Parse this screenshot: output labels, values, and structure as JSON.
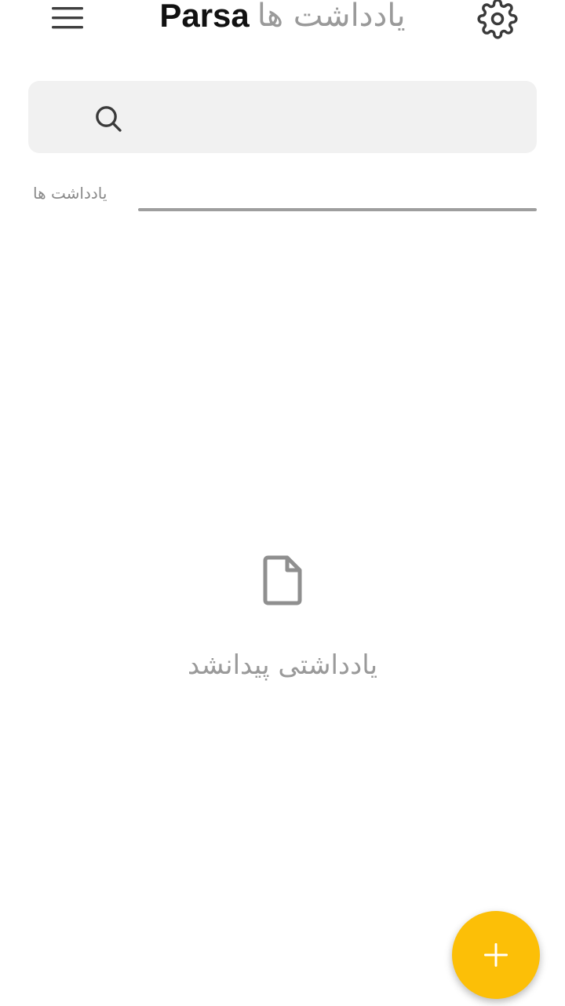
{
  "header": {
    "brand": "Parsa",
    "title": "یادداشت ها",
    "menu_icon": "hamburger-menu-icon",
    "settings_icon": "gear-icon"
  },
  "search": {
    "placeholder": "",
    "value": "",
    "icon": "search-icon"
  },
  "section": {
    "label": "یادداشت ها"
  },
  "empty_state": {
    "icon": "file-icon",
    "message": "یادداشتی پیدانشد"
  },
  "fab": {
    "icon": "plus-icon",
    "color": "#fcbf07"
  }
}
